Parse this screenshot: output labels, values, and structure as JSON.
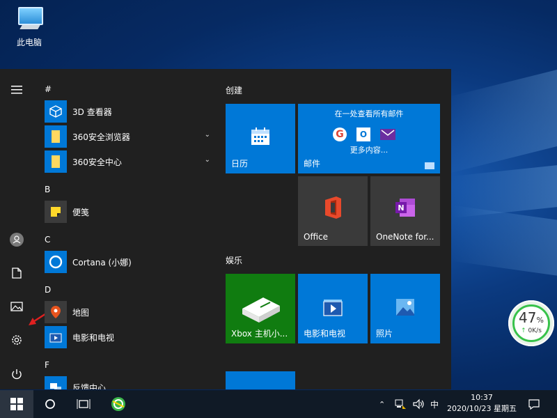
{
  "desktop": {
    "icon_label": "此电脑"
  },
  "rail": {
    "icons": [
      "hamburger-icon",
      "user-icon",
      "document-icon",
      "pictures-icon",
      "settings-icon",
      "power-icon"
    ]
  },
  "applist": {
    "sections": [
      {
        "letter": "#",
        "apps": [
          {
            "name": "3D 查看器",
            "icon": "cube-icon",
            "expandable": false
          },
          {
            "name": "360安全浏览器",
            "icon": "folder-icon",
            "expandable": true
          },
          {
            "name": "360安全中心",
            "icon": "folder-icon",
            "expandable": true
          }
        ]
      },
      {
        "letter": "B",
        "apps": [
          {
            "name": "便笺",
            "icon": "sticky-note-icon",
            "expandable": false
          }
        ]
      },
      {
        "letter": "C",
        "apps": [
          {
            "name": "Cortana (小娜)",
            "icon": "cortana-icon",
            "expandable": false
          }
        ]
      },
      {
        "letter": "D",
        "apps": [
          {
            "name": "地图",
            "icon": "map-pin-icon",
            "expandable": false
          },
          {
            "name": "电影和电视",
            "icon": "movies-icon",
            "expandable": false
          }
        ]
      },
      {
        "letter": "F",
        "apps": [
          {
            "name": "反馈中心",
            "icon": "feedback-icon",
            "expandable": false
          }
        ]
      }
    ]
  },
  "tiles": {
    "groups": [
      "创建",
      "娱乐"
    ],
    "calendar": "日历",
    "mail": {
      "label": "邮件",
      "headline": "在一处查看所有邮件",
      "more": "更多内容..."
    },
    "office": "Office",
    "onenote": "OneNote for...",
    "xbox": "Xbox 主机小...",
    "movies": "电影和电视",
    "photos": "照片"
  },
  "taskbar": {
    "ime": "中",
    "time": "10:37",
    "date": "2020/10/23 星期五"
  },
  "net_widget": {
    "percent": "47",
    "percent_sign": "%",
    "speed": "0K/s"
  },
  "colors": {
    "tile_blue": "#0078d7",
    "xbox_green": "#107c10",
    "tile_gray": "#3a3a3a",
    "menu_bg": "#202020"
  }
}
